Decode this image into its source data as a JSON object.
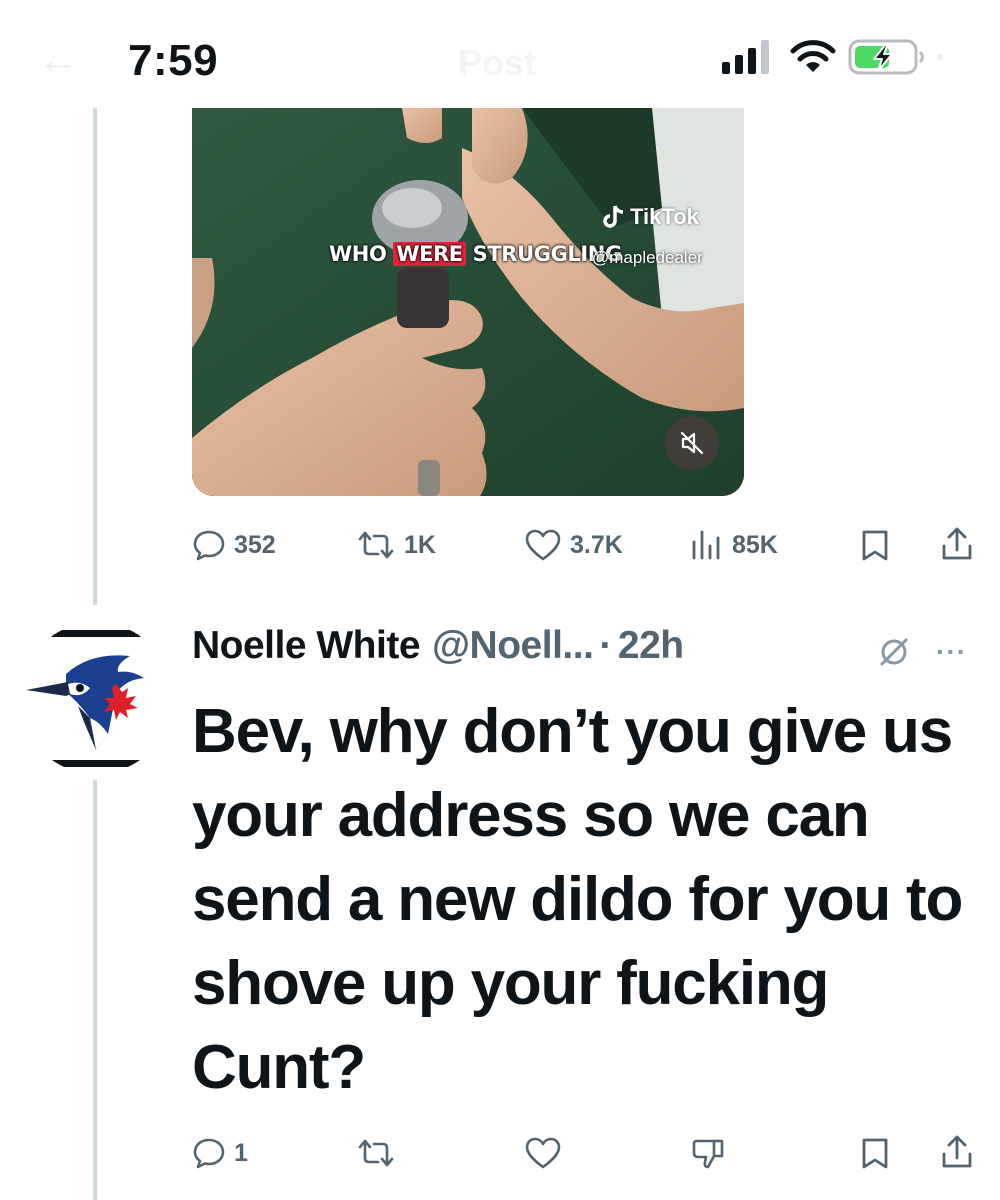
{
  "status_bar": {
    "time": "7:59",
    "ghost_title": "Post",
    "icons": [
      "back-arrow-icon",
      "cellular-signal-icon",
      "wifi-icon",
      "battery-charging-icon",
      "more-icon"
    ]
  },
  "video": {
    "caption_before": "WHO ",
    "caption_highlight": "WERE",
    "caption_after": " STRUGGLING",
    "watermark_brand": "TikTok",
    "watermark_handle": "@mapledealer",
    "mute_icon": "speaker-muted-icon"
  },
  "post_actions": {
    "replies": "352",
    "reposts": "1K",
    "likes": "3.7K",
    "views": "85K"
  },
  "reply": {
    "name": "Noelle White",
    "handle": "@Noell...",
    "dot": "·",
    "time": "22h",
    "avatar": "blue-jays-logo",
    "text": "Bev, why don’t you give us your address so we can send a new dildo for you to shove up your fucking Cunt?",
    "actions": {
      "replies": "1"
    }
  },
  "colors": {
    "text_primary": "#0f1419",
    "text_secondary": "#536471",
    "thread_line": "#cfd9de",
    "caption_highlight": "#e02438",
    "battery_green": "#4cd964"
  }
}
